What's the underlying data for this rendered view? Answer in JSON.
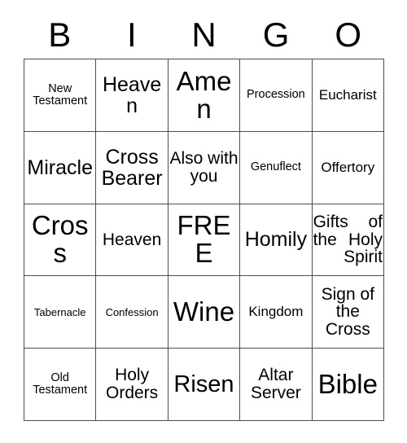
{
  "card": {
    "header_letters": [
      "B",
      "I",
      "N",
      "G",
      "O"
    ],
    "free_space_label": "FREE",
    "rows": [
      [
        {
          "text": "New Testament",
          "size": "xs"
        },
        {
          "text": "Heaven",
          "size": "l"
        },
        {
          "text": "Amen",
          "size": "xxl"
        },
        {
          "text": "Procession",
          "size": "xs"
        },
        {
          "text": "Eucharist",
          "size": "s"
        }
      ],
      [
        {
          "text": "Miracle",
          "size": "l"
        },
        {
          "text": "Cross Bearer",
          "size": "l"
        },
        {
          "text": "Also with you",
          "size": "m"
        },
        {
          "text": "Genuflect",
          "size": "xs"
        },
        {
          "text": "Offertory",
          "size": "s"
        }
      ],
      [
        {
          "text": "Cross",
          "size": "xxl"
        },
        {
          "text": "Heaven",
          "size": "m"
        },
        {
          "text": "FREE",
          "size": "xxl"
        },
        {
          "text": "Homily",
          "size": "l"
        },
        {
          "text": "Gifts of the Holy Spirit",
          "size": "m"
        }
      ],
      [
        {
          "text": "Tabernacle",
          "size": "xxs"
        },
        {
          "text": "Confession",
          "size": "xxs"
        },
        {
          "text": "Wine",
          "size": "xxl"
        },
        {
          "text": "Kingdom",
          "size": "s"
        },
        {
          "text": "Sign of the Cross",
          "size": "m"
        }
      ],
      [
        {
          "text": "Old Testament",
          "size": "xs"
        },
        {
          "text": "Holy Orders",
          "size": "m"
        },
        {
          "text": "Risen",
          "size": "xl"
        },
        {
          "text": "Altar Server",
          "size": "m"
        },
        {
          "text": "Bible",
          "size": "xxl"
        }
      ]
    ]
  },
  "colors": {
    "background": "#ffffff",
    "text": "#000000",
    "grid_line": "#4d4d4d"
  }
}
